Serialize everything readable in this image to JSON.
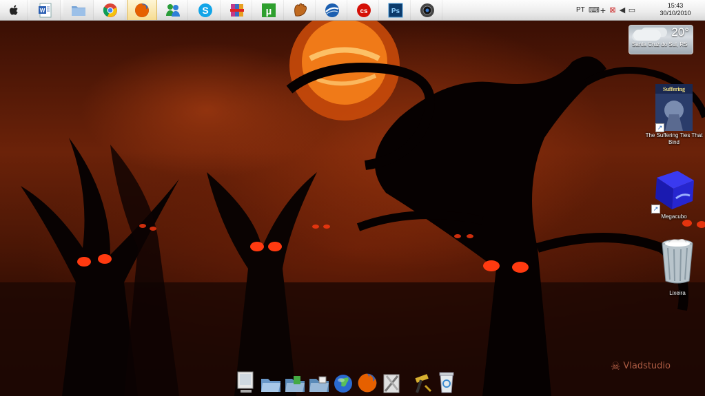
{
  "taskbar": {
    "apps": [
      {
        "icon": "apple-icon",
        "state": "normal"
      },
      {
        "icon": "word-icon",
        "state": "open"
      },
      {
        "icon": "folder-icon",
        "state": "open"
      },
      {
        "icon": "chrome-icon",
        "state": "normal"
      },
      {
        "icon": "firefox-icon",
        "state": "active"
      },
      {
        "icon": "messenger-icon",
        "state": "normal"
      },
      {
        "icon": "skype-icon",
        "state": "normal"
      },
      {
        "icon": "winrar-icon",
        "state": "normal"
      },
      {
        "icon": "utorrent-icon",
        "state": "normal"
      },
      {
        "icon": "baseball-glove-icon",
        "state": "normal"
      },
      {
        "icon": "google-earth-icon",
        "state": "normal"
      },
      {
        "icon": "lastfm-icon",
        "state": "normal"
      },
      {
        "icon": "photoshop-icon",
        "state": "normal"
      },
      {
        "icon": "webcam-icon",
        "state": "normal"
      }
    ],
    "tray": {
      "language": "PT",
      "time": "15:43",
      "date": "30/10/2010"
    },
    "colors": {
      "active_highlight": "#f6dc92"
    }
  },
  "weather": {
    "temperature": "20°",
    "location": "Santa Cruz do Sul, RS"
  },
  "desktop_icons": [
    {
      "label": "The Suffering Ties That Bind",
      "icon": "game-cover-icon"
    },
    {
      "label": "Megacubo",
      "icon": "megacubo-cube-icon"
    },
    {
      "label": "Lixeira",
      "icon": "recycle-bin-icon"
    }
  ],
  "dock": {
    "items": [
      "monitor-icon",
      "open-folder-icon",
      "downloads-folder-icon",
      "photos-folder-icon",
      "globe-icon",
      "firefox-icon",
      "tools-icon",
      "hammer-icon",
      "trash-icon"
    ]
  },
  "watermark": {
    "text": "Vladstudio"
  }
}
